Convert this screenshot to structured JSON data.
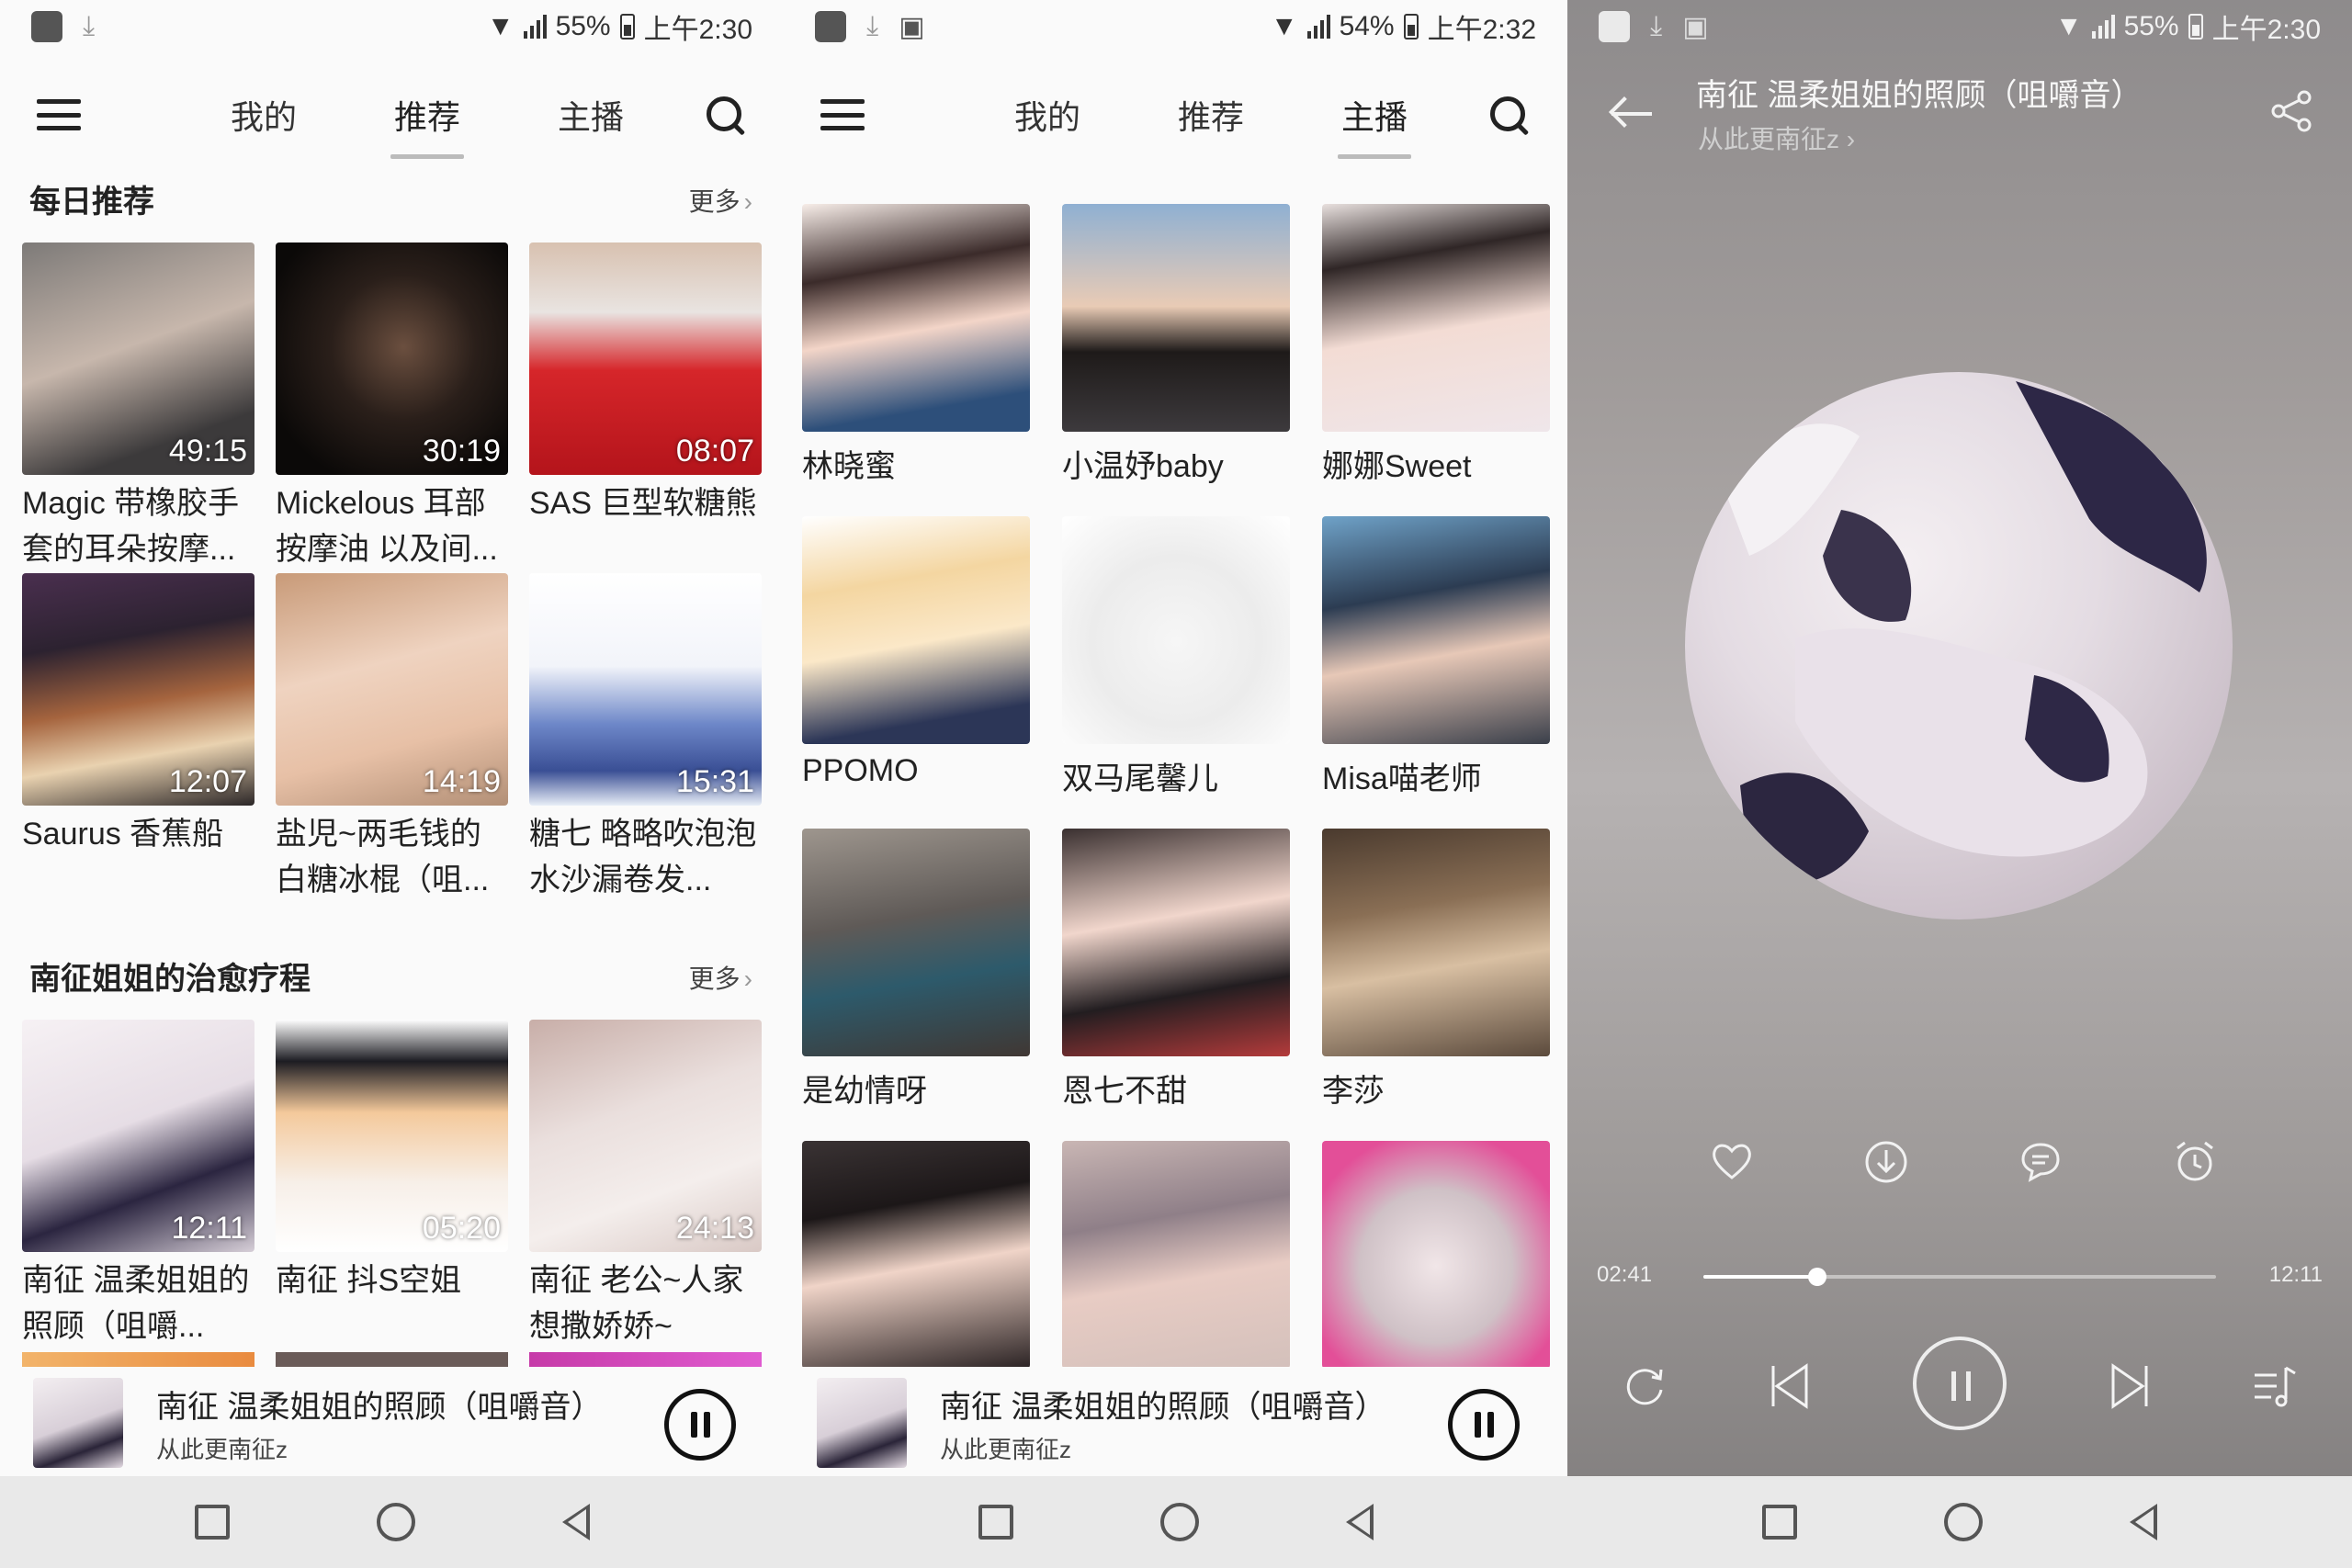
{
  "panels": [
    {
      "status": {
        "battery": "55%",
        "time": "上午2:30"
      },
      "nav": {
        "tabs": [
          "我的",
          "推荐",
          "主播"
        ],
        "active": 1
      }
    },
    {
      "status": {
        "battery": "54%",
        "time": "上午2:32"
      },
      "nav": {
        "tabs": [
          "我的",
          "推荐",
          "主播"
        ],
        "active": 2
      }
    },
    {
      "status": {
        "battery": "55%",
        "time": "上午2:30"
      }
    }
  ],
  "daily": {
    "title": "每日推荐",
    "more": "更多",
    "items": [
      {
        "title": "Magic 带橡胶手套的耳朵按摩...",
        "duration": "49:15"
      },
      {
        "title": "Mickelous 耳部按摩油 以及间...",
        "duration": "30:19"
      },
      {
        "title": "SAS 巨型软糖熊",
        "duration": "08:07"
      },
      {
        "title": "Saurus 香蕉船",
        "duration": "12:07"
      },
      {
        "title": "盐児~两毛钱的白糖冰棍（咀...",
        "duration": "14:19"
      },
      {
        "title": "糖七 略略吹泡泡水沙漏卷发...",
        "duration": "15:31"
      }
    ]
  },
  "healing": {
    "title": "南征姐姐的治愈疗程",
    "more": "更多",
    "items": [
      {
        "title": "南征 温柔姐姐的照顾（咀嚼...",
        "duration": "12:11"
      },
      {
        "title": "南征 抖S空姐",
        "duration": "05:20"
      },
      {
        "title": "南征 老公~人家想撒娇娇~",
        "duration": "24:13"
      }
    ]
  },
  "anchors": [
    {
      "name": "林晓蜜"
    },
    {
      "name": "小温妤baby"
    },
    {
      "name": "娜娜Sweet"
    },
    {
      "name": "PPOMO"
    },
    {
      "name": "双马尾馨儿"
    },
    {
      "name": "Misa喵老师"
    },
    {
      "name": "是幼情呀"
    },
    {
      "name": "恩七不甜"
    },
    {
      "name": "李莎"
    },
    {
      "name": ""
    },
    {
      "name": ""
    },
    {
      "name": ""
    }
  ],
  "miniplayer": {
    "title": "南征 温柔姐姐的照顾（咀嚼音）",
    "subtitle": "从此更南征z"
  },
  "player": {
    "title": "南征 温柔姐姐的照顾（咀嚼音）",
    "subtitle": "从此更南征z",
    "elapsed": "02:41",
    "total": "12:11",
    "progress": 0.2215,
    "actions": [
      "heart-icon",
      "download-icon",
      "comment-icon",
      "alarm-icon"
    ],
    "controls": [
      "repeat-icon",
      "previous-icon",
      "pause-icon",
      "next-icon",
      "playlist-icon"
    ]
  },
  "colors": {
    "accent_underline": "#bbbbbb",
    "page_bg": "#fafafa",
    "navbar_bg": "#e9e9e9",
    "player_bg": "#9e9a99"
  }
}
